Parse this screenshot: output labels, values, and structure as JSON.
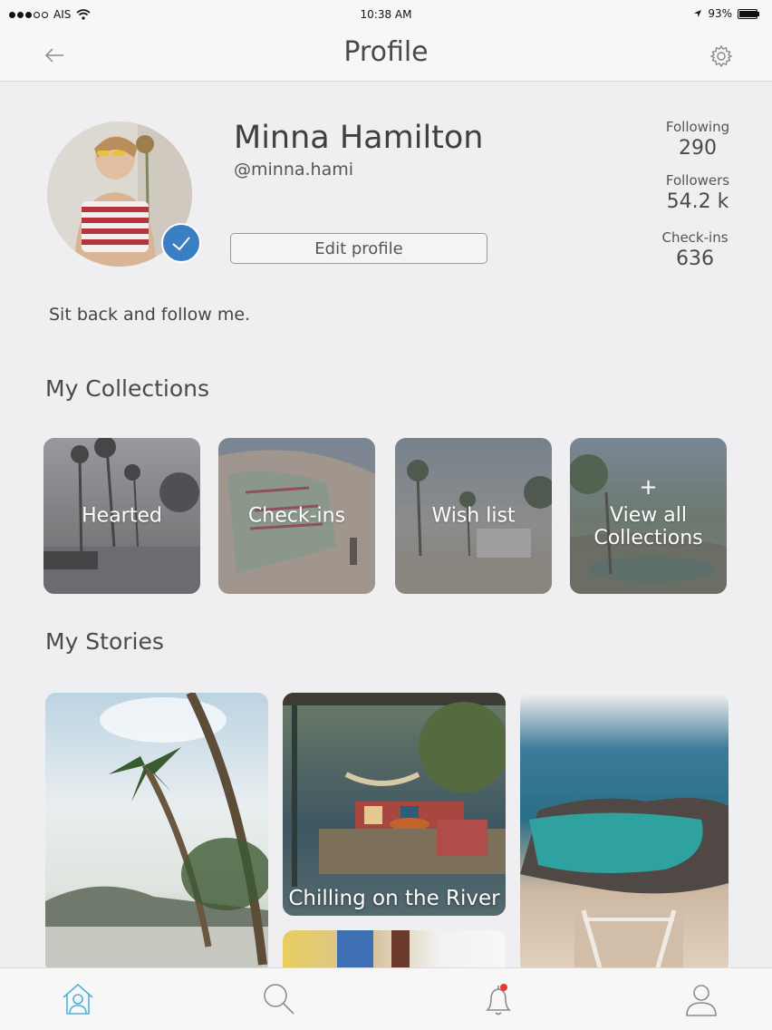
{
  "status_bar": {
    "carrier": "AIS",
    "time": "10:38 AM",
    "battery": "93%"
  },
  "nav": {
    "title": "Profile",
    "back_icon": "arrow-left-icon",
    "settings_icon": "gear-icon"
  },
  "profile": {
    "name": "Minna Hamilton",
    "handle": "@minna.hami",
    "edit_label": "Edit profile",
    "bio": "Sit back and follow me.",
    "verified_icon": "checkmark-icon"
  },
  "stats": [
    {
      "label": "Following",
      "value": "290"
    },
    {
      "label": "Followers",
      "value": "54.2 k"
    },
    {
      "label": "Check-ins",
      "value": "636"
    }
  ],
  "collections": {
    "title": "My Collections",
    "items": [
      {
        "label": "Hearted"
      },
      {
        "label": "Check-ins"
      },
      {
        "label": "Wish list"
      },
      {
        "label": "View all Collections",
        "icon": "plus-icon"
      }
    ]
  },
  "stories": {
    "title": "My  Stories",
    "items": [
      {
        "caption": ""
      },
      {
        "caption": "Chilling on the River"
      },
      {
        "caption": ""
      },
      {
        "caption": ""
      }
    ]
  },
  "tab_bar": {
    "items": [
      {
        "name": "home",
        "icon": "home-person-icon",
        "active": true
      },
      {
        "name": "search",
        "icon": "search-icon",
        "active": false
      },
      {
        "name": "notifications",
        "icon": "bell-icon",
        "active": false
      },
      {
        "name": "profile",
        "icon": "user-icon",
        "active": false
      }
    ],
    "accent": "#4fb3d9",
    "notification_dot": "#e53935"
  },
  "colors": {
    "verified_badge": "#3a7ec3",
    "background": "#efeff1"
  }
}
